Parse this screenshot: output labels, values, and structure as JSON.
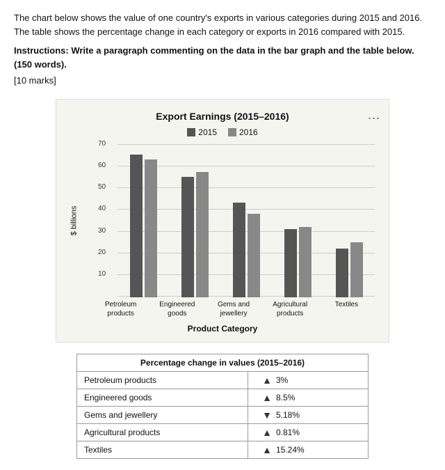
{
  "intro": {
    "text": "The chart below shows the value of one country's exports in various categories during 2015 and 2016. The table shows the percentage change in each category or exports in 2016 compared with 2015.",
    "instructions": "Instructions: Write a paragraph commenting on the data in the bar graph and the table below. (150 words).",
    "marks": "[10 marks]"
  },
  "chart": {
    "title": "Export Earnings (2015–2016)",
    "legend_2015": "2015",
    "legend_2016": "2016",
    "y_label": "$ billions",
    "y_axis": [
      70,
      60,
      50,
      40,
      30,
      20,
      10
    ],
    "product_category_label": "Product Category",
    "three_dots": "...",
    "categories": [
      {
        "name": "Petroleum\nproducts",
        "val2015": 65,
        "val2016": 63
      },
      {
        "name": "Engineered\ngoods",
        "val2015": 55,
        "val2016": 57
      },
      {
        "name": "Gems and\njewellery",
        "val2015": 43,
        "val2016": 38
      },
      {
        "name": "Agricultural\nproducts",
        "val2015": 31,
        "val2016": 32
      },
      {
        "name": "Textiles",
        "val2015": 22,
        "val2016": 25
      }
    ],
    "max_value": 70
  },
  "table": {
    "header": "Percentage change in values (2015–2016)",
    "rows": [
      {
        "category": "Petroleum products",
        "direction": "up",
        "value": "3%"
      },
      {
        "category": "Engineered goods",
        "direction": "up",
        "value": "8.5%"
      },
      {
        "category": "Gems and jewellery",
        "direction": "down",
        "value": "5.18%"
      },
      {
        "category": "Agricultural products",
        "direction": "up",
        "value": "0.81%"
      },
      {
        "category": "Textiles",
        "direction": "up",
        "value": "15.24%"
      }
    ]
  }
}
